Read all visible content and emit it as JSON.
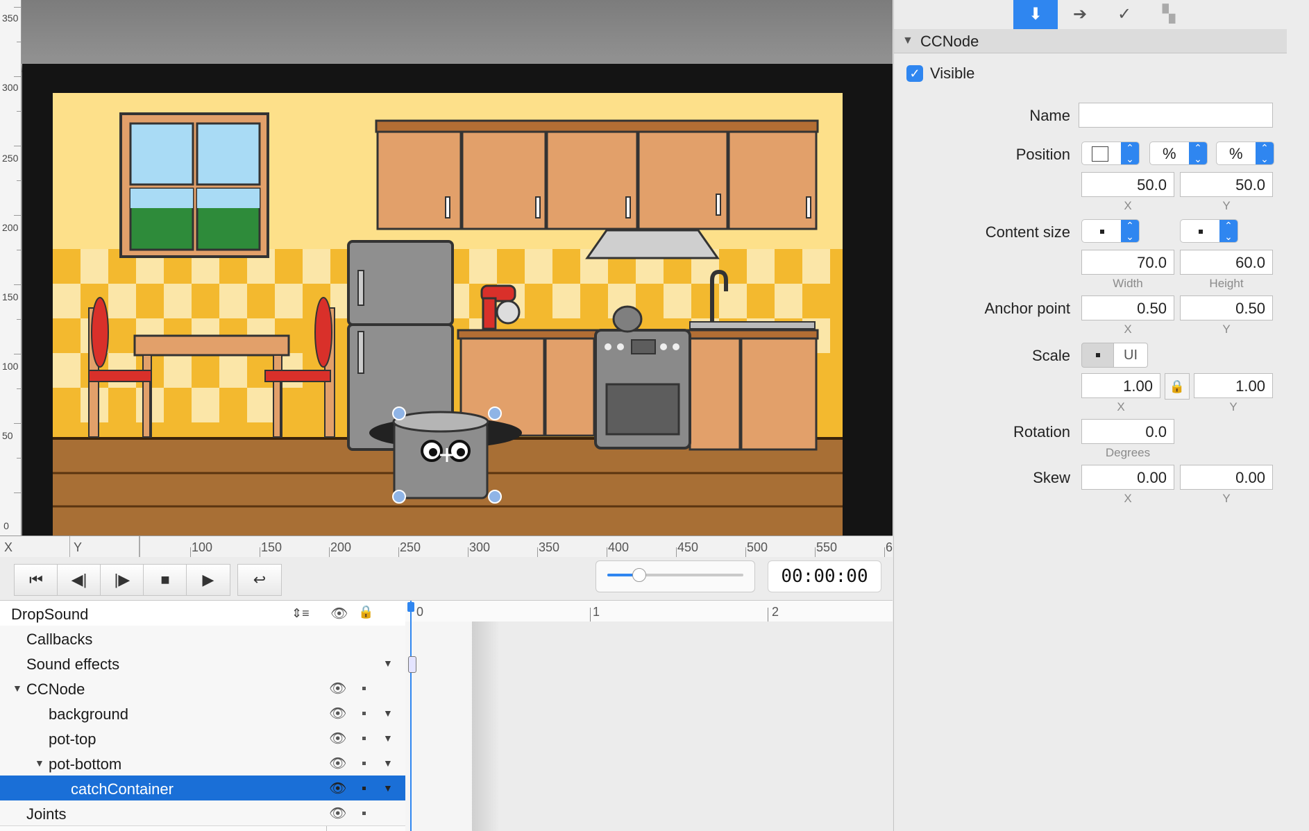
{
  "ruler_v": [
    "350",
    "300",
    "250",
    "200",
    "150",
    "100",
    "50",
    "0"
  ],
  "ruler_h": {
    "x_label": "X",
    "y_label": "Y",
    "ticks": [
      "100",
      "150",
      "200",
      "250",
      "300",
      "350",
      "400",
      "450",
      "500",
      "550",
      "6"
    ]
  },
  "transport": {
    "buttons": [
      "jump-start",
      "step-back",
      "step-forward",
      "stop",
      "play",
      "loop"
    ],
    "timecode": "00:00:00"
  },
  "outline": {
    "header": "DropSound",
    "rows": [
      {
        "label": "Callbacks",
        "indent": 1,
        "expander": false
      },
      {
        "label": "Sound effects",
        "indent": 1,
        "expander": false
      },
      {
        "label": "CCNode",
        "indent": 1,
        "expander": true
      },
      {
        "label": "background",
        "indent": 2,
        "expander": false
      },
      {
        "label": "pot-top",
        "indent": 2,
        "expander": false
      },
      {
        "label": "pot-bottom",
        "indent": 2,
        "expander": true
      },
      {
        "label": "catchContainer",
        "indent": 3,
        "expander": false,
        "selected": true
      },
      {
        "label": "Joints",
        "indent": 1,
        "expander": false
      }
    ]
  },
  "timeline": {
    "markers": [
      "0",
      "1",
      "2"
    ]
  },
  "inspector": {
    "tabs": [
      "properties-icon",
      "code-connections-icon",
      "physics-icon",
      "templates-icon"
    ],
    "section_title": "CCNode",
    "visible_label": "Visible",
    "name_label": "Name",
    "name_value": "",
    "position_label": "Position",
    "position_unit_x": "%",
    "position_unit_y": "%",
    "position_x": "50.0",
    "position_y": "50.0",
    "x_sub": "X",
    "y_sub": "Y",
    "content_size_label": "Content size",
    "content_width": "70.0",
    "content_height": "60.0",
    "width_sub": "Width",
    "height_sub": "Height",
    "anchor_label": "Anchor point",
    "anchor_x": "0.50",
    "anchor_y": "0.50",
    "scale_label": "Scale",
    "scale_ui": "UI",
    "scale_x": "1.00",
    "scale_y": "1.00",
    "rotation_label": "Rotation",
    "rotation_value": "0.0",
    "degrees_sub": "Degrees",
    "skew_label": "Skew",
    "skew_x": "0.00",
    "skew_y": "0.00"
  },
  "colors": {
    "selection": "#1a6fd7",
    "tab_active": "#2f86f0",
    "wall": "#fde08a",
    "tile": "#f3b92f",
    "cabinet": "#e2a06a",
    "floor": "#a86f35"
  }
}
